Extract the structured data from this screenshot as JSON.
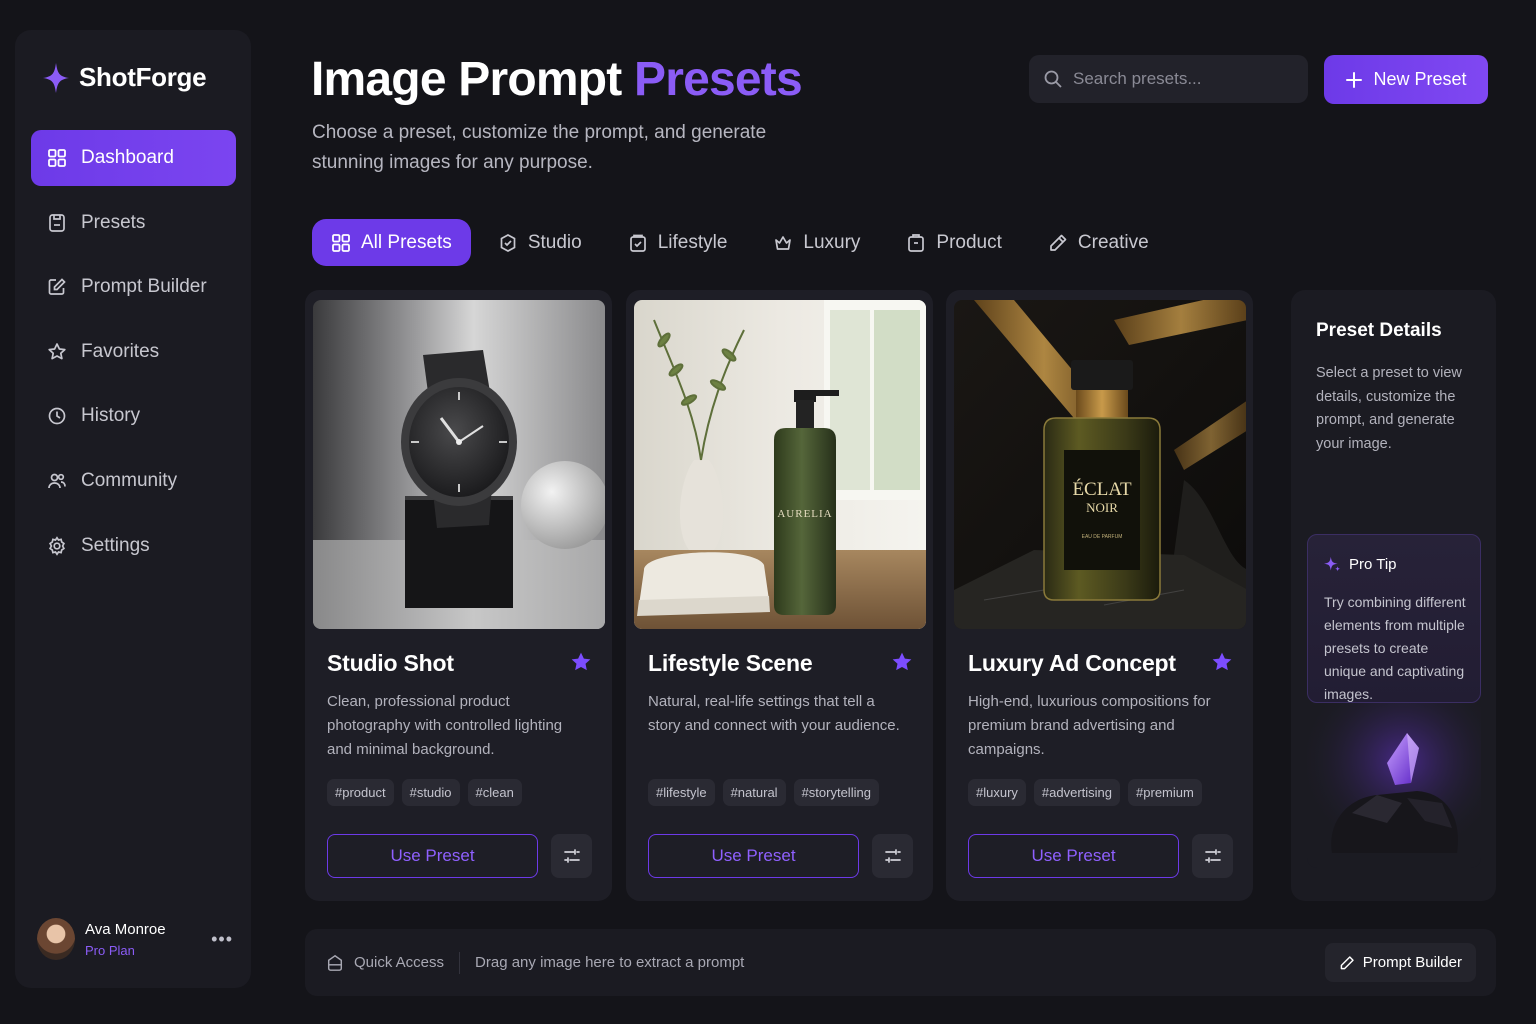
{
  "app": {
    "name": "ShotForge"
  },
  "sidebar": {
    "items": [
      {
        "label": "Dashboard",
        "icon": "grid-icon",
        "active": true
      },
      {
        "label": "Presets",
        "icon": "presets-icon"
      },
      {
        "label": "Prompt Builder",
        "icon": "edit-icon"
      },
      {
        "label": "Favorites",
        "icon": "star-icon"
      },
      {
        "label": "History",
        "icon": "clock-icon"
      },
      {
        "label": "Community",
        "icon": "users-icon"
      },
      {
        "label": "Settings",
        "icon": "gear-icon"
      }
    ],
    "user": {
      "name": "Ava Monroe",
      "plan": "Pro Plan"
    }
  },
  "header": {
    "title_main": "Image Prompt",
    "title_accent": "Presets",
    "subtitle": "Choose a preset, customize the prompt, and generate stunning images for any purpose.",
    "search_placeholder": "Search presets...",
    "new_button": "New Preset"
  },
  "tabs": [
    {
      "label": "All Presets",
      "icon": "grid-icon",
      "active": true
    },
    {
      "label": "Studio",
      "icon": "studio-icon"
    },
    {
      "label": "Lifestyle",
      "icon": "lifestyle-icon"
    },
    {
      "label": "Luxury",
      "icon": "crown-icon"
    },
    {
      "label": "Product",
      "icon": "box-icon"
    },
    {
      "label": "Creative",
      "icon": "pencil-icon"
    }
  ],
  "presets": [
    {
      "title": "Studio Shot",
      "description": "Clean, professional product photography with controlled lighting and minimal background.",
      "tags": [
        "#product",
        "#studio",
        "#clean"
      ],
      "button": "Use Preset",
      "favorite": true
    },
    {
      "title": "Lifestyle Scene",
      "description": "Natural, real-life settings that tell a story and connect with your audience.",
      "tags": [
        "#lifestyle",
        "#natural",
        "#storytelling"
      ],
      "button": "Use Preset",
      "favorite": true,
      "product_label": "AURELIA"
    },
    {
      "title": "Luxury Ad Concept",
      "description": "High-end, luxurious compositions for premium brand advertising and campaigns.",
      "tags": [
        "#luxury",
        "#advertising",
        "#premium"
      ],
      "button": "Use Preset",
      "favorite": true,
      "product_label_1": "ÉCLAT",
      "product_label_2": "NOIR",
      "product_label_3": "EAU DE PARFUM"
    }
  ],
  "details": {
    "title": "Preset Details",
    "text": "Select a preset to view details, customize the prompt, and generate your image.",
    "tip_title": "Pro Tip",
    "tip_text": "Try combining different elements from multiple presets to create unique and captivating images."
  },
  "footer": {
    "quick_access": "Quick Access",
    "drag_text": "Drag any image here to extract a prompt",
    "prompt_builder": "Prompt Builder"
  },
  "colors": {
    "accent": "#6d3ae8",
    "accent_text": "#8b5cf6",
    "background": "#141419",
    "panel": "#1b1b22"
  }
}
